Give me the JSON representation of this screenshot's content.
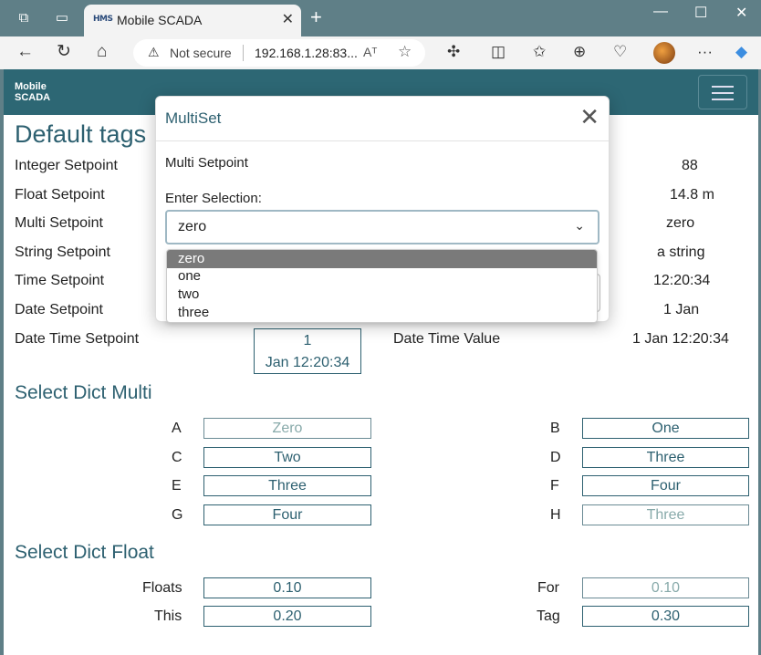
{
  "browser": {
    "tab_title": "Mobile SCADA",
    "tab_favicon": "HMS",
    "address_warning": "Not secure",
    "address_url": "192.168.1.28:83...",
    "read_aloud": "Aᵀ",
    "icons": [
      "workspaces-icon",
      "tab-actions-icon",
      "close-tab-icon",
      "new-tab-icon",
      "minimize-icon",
      "maximize-icon",
      "window-close-icon",
      "back-icon",
      "refresh-icon",
      "home-icon",
      "warning-icon",
      "read-aloud-icon",
      "favorite-star-icon",
      "extensions-icon",
      "split-screen-icon",
      "favorites-icon",
      "collections-icon",
      "browser-essentials-icon",
      "profile-avatar",
      "more-icon",
      "copilot-icon"
    ]
  },
  "app": {
    "brand": "Mobile\nSCADA",
    "menu_icon": "hamburger-menu-icon"
  },
  "default_tags": {
    "heading": "Default tags",
    "rows": [
      {
        "label": "Integer Setpoint",
        "value": "88"
      },
      {
        "label": "Float Setpoint",
        "value": "14.8 m"
      },
      {
        "label": "Multi Setpoint",
        "value": "zero"
      },
      {
        "label": "String Setpoint",
        "value": "a string"
      },
      {
        "label": "Time Setpoint",
        "value": "12:20:34"
      },
      {
        "label": "Date Setpoint",
        "value": "1 Jan"
      },
      {
        "label": "Date Time Setpoint",
        "value": "1 Jan 12:20:34"
      }
    ],
    "date_time_field_line1": "1",
    "date_time_field_line2": "Jan 12:20:34",
    "date_time_value_label": "Date Time Value"
  },
  "select_dict_multi": {
    "heading": "Select Dict Multi",
    "items": [
      {
        "label": "A",
        "value": "Zero"
      },
      {
        "label": "B",
        "value": "One"
      },
      {
        "label": "C",
        "value": "Two"
      },
      {
        "label": "D",
        "value": "Three"
      },
      {
        "label": "E",
        "value": "Three"
      },
      {
        "label": "F",
        "value": "Four"
      },
      {
        "label": "G",
        "value": "Four"
      },
      {
        "label": "H",
        "value": "Three"
      }
    ]
  },
  "select_dict_float": {
    "heading": "Select Dict Float",
    "items": [
      {
        "label": "Floats",
        "value": "0.10"
      },
      {
        "label": "For",
        "value": "0.10"
      },
      {
        "label": "This",
        "value": "0.20"
      },
      {
        "label": "Tag",
        "value": "0.30"
      }
    ]
  },
  "modal": {
    "title": "MultiSet",
    "subtitle": "Multi Setpoint",
    "enter_label": "Enter Selection:",
    "selected": "zero",
    "options": [
      "zero",
      "one",
      "two",
      "three"
    ]
  }
}
